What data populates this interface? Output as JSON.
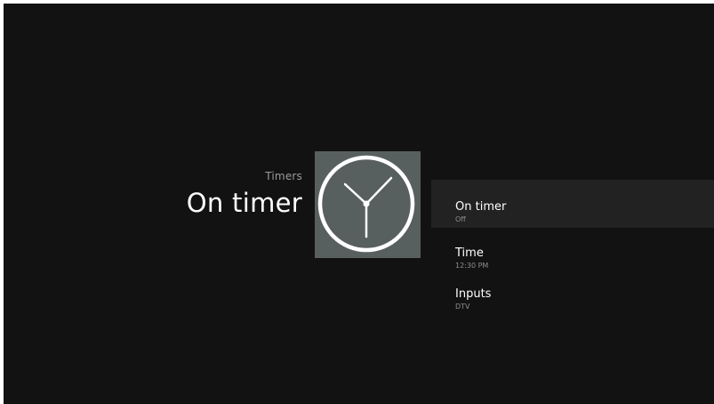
{
  "header": {
    "breadcrumb": "Timers",
    "title": "On timer"
  },
  "hero_icon": "clock-icon",
  "menu": {
    "items": [
      {
        "label": "On timer",
        "value": "Off",
        "selected": true
      },
      {
        "label": "Time",
        "value": "12:30 PM",
        "selected": false
      },
      {
        "label": "Inputs",
        "value": "DTV",
        "selected": false
      }
    ]
  },
  "colors": {
    "background": "#121212",
    "tile": "#58605f",
    "selected_row": "#222222",
    "secondary_text": "#8e8e8e"
  }
}
